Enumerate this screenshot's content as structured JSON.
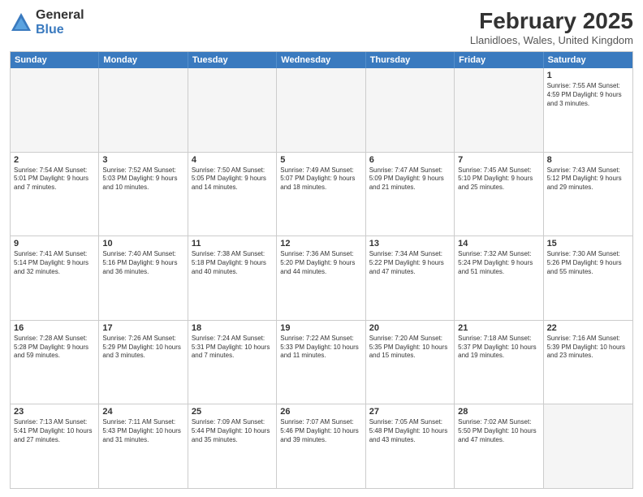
{
  "header": {
    "logo_general": "General",
    "logo_blue": "Blue",
    "month_year": "February 2025",
    "location": "Llanidloes, Wales, United Kingdom"
  },
  "weekdays": [
    "Sunday",
    "Monday",
    "Tuesday",
    "Wednesday",
    "Thursday",
    "Friday",
    "Saturday"
  ],
  "rows": [
    [
      {
        "day": "",
        "text": "",
        "empty": true
      },
      {
        "day": "",
        "text": "",
        "empty": true
      },
      {
        "day": "",
        "text": "",
        "empty": true
      },
      {
        "day": "",
        "text": "",
        "empty": true
      },
      {
        "day": "",
        "text": "",
        "empty": true
      },
      {
        "day": "",
        "text": "",
        "empty": true
      },
      {
        "day": "1",
        "text": "Sunrise: 7:55 AM\nSunset: 4:59 PM\nDaylight: 9 hours and 3 minutes.",
        "empty": false
      }
    ],
    [
      {
        "day": "2",
        "text": "Sunrise: 7:54 AM\nSunset: 5:01 PM\nDaylight: 9 hours and 7 minutes.",
        "empty": false
      },
      {
        "day": "3",
        "text": "Sunrise: 7:52 AM\nSunset: 5:03 PM\nDaylight: 9 hours and 10 minutes.",
        "empty": false
      },
      {
        "day": "4",
        "text": "Sunrise: 7:50 AM\nSunset: 5:05 PM\nDaylight: 9 hours and 14 minutes.",
        "empty": false
      },
      {
        "day": "5",
        "text": "Sunrise: 7:49 AM\nSunset: 5:07 PM\nDaylight: 9 hours and 18 minutes.",
        "empty": false
      },
      {
        "day": "6",
        "text": "Sunrise: 7:47 AM\nSunset: 5:09 PM\nDaylight: 9 hours and 21 minutes.",
        "empty": false
      },
      {
        "day": "7",
        "text": "Sunrise: 7:45 AM\nSunset: 5:10 PM\nDaylight: 9 hours and 25 minutes.",
        "empty": false
      },
      {
        "day": "8",
        "text": "Sunrise: 7:43 AM\nSunset: 5:12 PM\nDaylight: 9 hours and 29 minutes.",
        "empty": false
      }
    ],
    [
      {
        "day": "9",
        "text": "Sunrise: 7:41 AM\nSunset: 5:14 PM\nDaylight: 9 hours and 32 minutes.",
        "empty": false
      },
      {
        "day": "10",
        "text": "Sunrise: 7:40 AM\nSunset: 5:16 PM\nDaylight: 9 hours and 36 minutes.",
        "empty": false
      },
      {
        "day": "11",
        "text": "Sunrise: 7:38 AM\nSunset: 5:18 PM\nDaylight: 9 hours and 40 minutes.",
        "empty": false
      },
      {
        "day": "12",
        "text": "Sunrise: 7:36 AM\nSunset: 5:20 PM\nDaylight: 9 hours and 44 minutes.",
        "empty": false
      },
      {
        "day": "13",
        "text": "Sunrise: 7:34 AM\nSunset: 5:22 PM\nDaylight: 9 hours and 47 minutes.",
        "empty": false
      },
      {
        "day": "14",
        "text": "Sunrise: 7:32 AM\nSunset: 5:24 PM\nDaylight: 9 hours and 51 minutes.",
        "empty": false
      },
      {
        "day": "15",
        "text": "Sunrise: 7:30 AM\nSunset: 5:26 PM\nDaylight: 9 hours and 55 minutes.",
        "empty": false
      }
    ],
    [
      {
        "day": "16",
        "text": "Sunrise: 7:28 AM\nSunset: 5:28 PM\nDaylight: 9 hours and 59 minutes.",
        "empty": false
      },
      {
        "day": "17",
        "text": "Sunrise: 7:26 AM\nSunset: 5:29 PM\nDaylight: 10 hours and 3 minutes.",
        "empty": false
      },
      {
        "day": "18",
        "text": "Sunrise: 7:24 AM\nSunset: 5:31 PM\nDaylight: 10 hours and 7 minutes.",
        "empty": false
      },
      {
        "day": "19",
        "text": "Sunrise: 7:22 AM\nSunset: 5:33 PM\nDaylight: 10 hours and 11 minutes.",
        "empty": false
      },
      {
        "day": "20",
        "text": "Sunrise: 7:20 AM\nSunset: 5:35 PM\nDaylight: 10 hours and 15 minutes.",
        "empty": false
      },
      {
        "day": "21",
        "text": "Sunrise: 7:18 AM\nSunset: 5:37 PM\nDaylight: 10 hours and 19 minutes.",
        "empty": false
      },
      {
        "day": "22",
        "text": "Sunrise: 7:16 AM\nSunset: 5:39 PM\nDaylight: 10 hours and 23 minutes.",
        "empty": false
      }
    ],
    [
      {
        "day": "23",
        "text": "Sunrise: 7:13 AM\nSunset: 5:41 PM\nDaylight: 10 hours and 27 minutes.",
        "empty": false
      },
      {
        "day": "24",
        "text": "Sunrise: 7:11 AM\nSunset: 5:43 PM\nDaylight: 10 hours and 31 minutes.",
        "empty": false
      },
      {
        "day": "25",
        "text": "Sunrise: 7:09 AM\nSunset: 5:44 PM\nDaylight: 10 hours and 35 minutes.",
        "empty": false
      },
      {
        "day": "26",
        "text": "Sunrise: 7:07 AM\nSunset: 5:46 PM\nDaylight: 10 hours and 39 minutes.",
        "empty": false
      },
      {
        "day": "27",
        "text": "Sunrise: 7:05 AM\nSunset: 5:48 PM\nDaylight: 10 hours and 43 minutes.",
        "empty": false
      },
      {
        "day": "28",
        "text": "Sunrise: 7:02 AM\nSunset: 5:50 PM\nDaylight: 10 hours and 47 minutes.",
        "empty": false
      },
      {
        "day": "",
        "text": "",
        "empty": true
      }
    ]
  ]
}
